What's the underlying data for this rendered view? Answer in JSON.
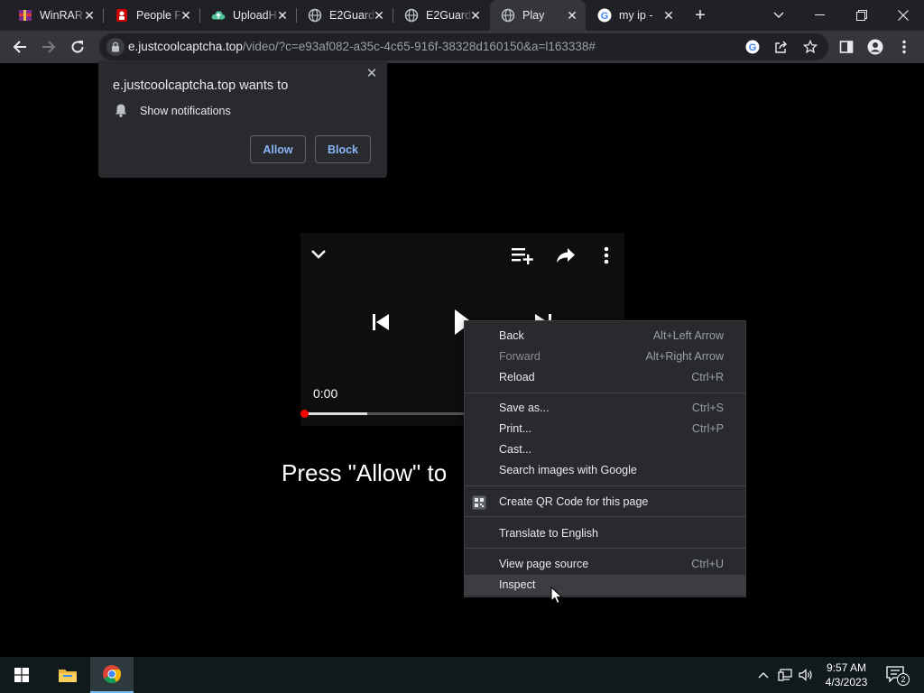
{
  "tabs": [
    {
      "title": "WinRAR",
      "icon": "winrar-icon"
    },
    {
      "title": "People F",
      "icon": "people-icon"
    },
    {
      "title": "UploadH",
      "icon": "cloud-icon"
    },
    {
      "title": "E2Guard",
      "icon": "globe-icon"
    },
    {
      "title": "E2Guard",
      "icon": "globe-icon"
    },
    {
      "title": "Play",
      "icon": "globe-icon",
      "active": true
    },
    {
      "title": "my ip -",
      "icon": "google-icon"
    }
  ],
  "address_bar": {
    "host": "e.justcoolcaptcha.top",
    "path": "/video/?c=e93af082-a35c-4c65-916f-38328d160150&a=l163338#"
  },
  "notification_prompt": {
    "title": "e.justcoolcaptcha.top wants to",
    "permission": "Show notifications",
    "allow_label": "Allow",
    "block_label": "Block",
    "close_glyph": "✕"
  },
  "player": {
    "time": "0:00",
    "progress": 0.2
  },
  "page_text": "Press \"Allow\" to",
  "context_menu": {
    "groups": [
      [
        {
          "label": "Back",
          "shortcut": "Alt+Left Arrow"
        },
        {
          "label": "Forward",
          "shortcut": "Alt+Right Arrow",
          "disabled": true
        },
        {
          "label": "Reload",
          "shortcut": "Ctrl+R"
        }
      ],
      [
        {
          "label": "Save as...",
          "shortcut": "Ctrl+S"
        },
        {
          "label": "Print...",
          "shortcut": "Ctrl+P"
        },
        {
          "label": "Cast...",
          "shortcut": ""
        },
        {
          "label": "Search images with Google",
          "shortcut": ""
        }
      ],
      [
        {
          "label": "Create QR Code for this page",
          "shortcut": "",
          "icon": "qr-code-icon"
        }
      ],
      [
        {
          "label": "Translate to English",
          "shortcut": ""
        }
      ],
      [
        {
          "label": "View page source",
          "shortcut": "Ctrl+U"
        },
        {
          "label": "Inspect",
          "shortcut": "",
          "hover": true
        }
      ]
    ]
  },
  "taskbar": {
    "time": "9:57 AM",
    "date": "4/3/2023",
    "notification_count": "2"
  },
  "colors": {
    "accent": "#8ab4f8",
    "tab_bar": "#202124",
    "toolbar": "#35363a",
    "menu": "#292a2d",
    "progress_knob": "#ff0000"
  }
}
